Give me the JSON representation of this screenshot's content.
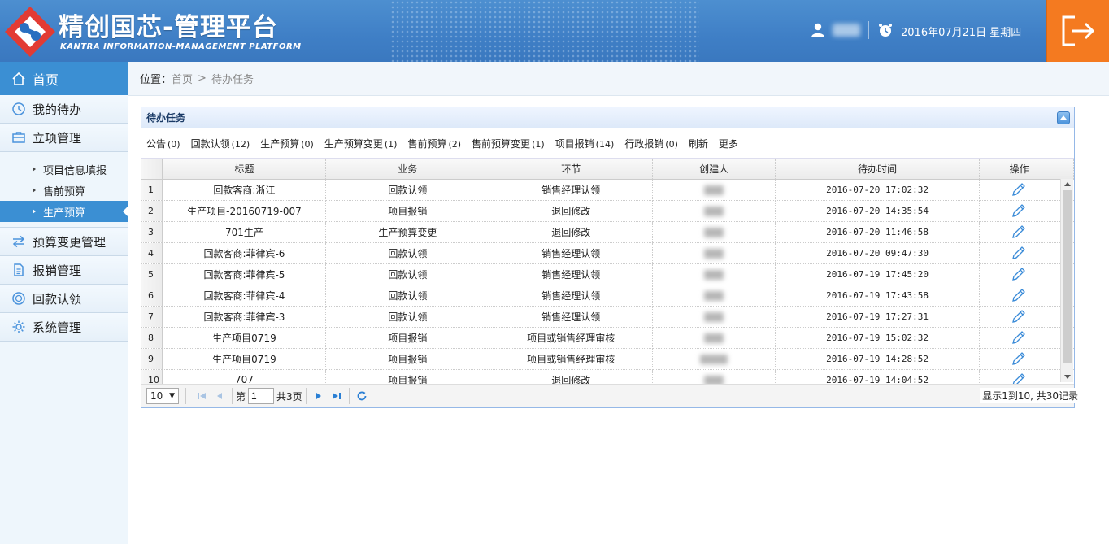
{
  "header": {
    "title": "精创国芯-管理平台",
    "subtitle": "KANTRA INFORMATION-MANAGEMENT PLATFORM",
    "date": "2016年07月21日  星期四",
    "colors": {
      "header_blue": "#3f7fc6",
      "logout_orange": "#f47a20"
    }
  },
  "sidebar": {
    "home": "首页",
    "items": [
      {
        "label": "我的待办",
        "icon": "clock-icon"
      },
      {
        "label": "立项管理",
        "icon": "briefcase-icon"
      }
    ],
    "sub_items": [
      {
        "label": "项目信息填报"
      },
      {
        "label": "售前预算"
      },
      {
        "label": "生产预算"
      }
    ],
    "items2": [
      {
        "label": "预算变更管理",
        "icon": "swap-icon"
      },
      {
        "label": "报销管理",
        "icon": "document-icon"
      },
      {
        "label": "回款认领",
        "icon": "coin-icon"
      },
      {
        "label": "系统管理",
        "icon": "gear-icon"
      }
    ]
  },
  "breadcrumb": {
    "label": "位置：",
    "home": "首页",
    "sep": ">",
    "current": "待办任务"
  },
  "panel": {
    "title": "待办任务",
    "tabs": [
      {
        "label": "公告",
        "count": "(0)"
      },
      {
        "label": "回款认领",
        "count": "(12)"
      },
      {
        "label": "生产预算",
        "count": "(0)"
      },
      {
        "label": "生产预算变更",
        "count": "(1)"
      },
      {
        "label": "售前预算",
        "count": "(2)"
      },
      {
        "label": "售前预算变更",
        "count": "(1)"
      },
      {
        "label": "项目报销",
        "count": "(14)"
      },
      {
        "label": "行政报销",
        "count": "(0)"
      },
      {
        "label": "刷新",
        "count": ""
      },
      {
        "label": "更多",
        "count": ""
      }
    ]
  },
  "table": {
    "columns": [
      "标题",
      "业务",
      "环节",
      "创建人",
      "待办时间",
      "操作"
    ],
    "rows": [
      {
        "n": "1",
        "title": "回款客商:浙江",
        "biz": "回款认领",
        "step": "销售经理认领",
        "time": "2016-07-20 17:02:32"
      },
      {
        "n": "2",
        "title": "生产项目-20160719-007",
        "biz": "项目报销",
        "step": "退回修改",
        "time": "2016-07-20 14:35:54"
      },
      {
        "n": "3",
        "title": "701生产",
        "biz": "生产预算变更",
        "step": "退回修改",
        "time": "2016-07-20 11:46:58"
      },
      {
        "n": "4",
        "title": "回款客商:菲律宾-6",
        "biz": "回款认领",
        "step": "销售经理认领",
        "time": "2016-07-20 09:47:30"
      },
      {
        "n": "5",
        "title": "回款客商:菲律宾-5",
        "biz": "回款认领",
        "step": "销售经理认领",
        "time": "2016-07-19 17:45:20"
      },
      {
        "n": "6",
        "title": "回款客商:菲律宾-4",
        "biz": "回款认领",
        "step": "销售经理认领",
        "time": "2016-07-19 17:43:58"
      },
      {
        "n": "7",
        "title": "回款客商:菲律宾-3",
        "biz": "回款认领",
        "step": "销售经理认领",
        "time": "2016-07-19 17:27:31"
      },
      {
        "n": "8",
        "title": "生产项目0719",
        "biz": "项目报销",
        "step": "项目或销售经理审核",
        "time": "2016-07-19 15:02:32"
      },
      {
        "n": "9",
        "title": "生产项目0719",
        "biz": "项目报销",
        "step": "项目或销售经理审核",
        "time": "2016-07-19 14:28:52"
      },
      {
        "n": "10",
        "title": "707",
        "biz": "项目报销",
        "step": "退回修改",
        "time": "2016-07-19 14:04:52"
      }
    ]
  },
  "pager": {
    "page_size": "10",
    "page_prefix": "第",
    "page_value": "1",
    "page_total": "共3页",
    "info": "显示1到10, 共30记录"
  }
}
